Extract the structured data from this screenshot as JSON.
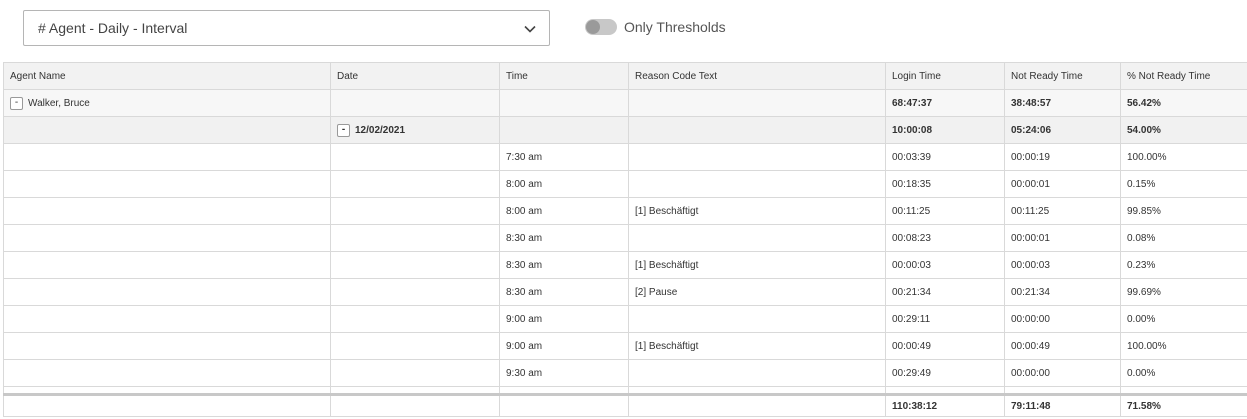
{
  "report_select": {
    "value": "# Agent - Daily - Interval"
  },
  "threshold_toggle": {
    "label": "Only Thresholds",
    "on": false
  },
  "table": {
    "columns": [
      "Agent Name",
      "Date",
      "Time",
      "Reason Code Text",
      "Login Time",
      "Not Ready Time",
      "% Not Ready Time"
    ],
    "group": {
      "expander": "-",
      "agent": "Walker, Bruce",
      "login": "68:47:37",
      "not_ready": "38:48:57",
      "pct": "56.42%"
    },
    "subgroup": {
      "expander": "-",
      "date": "12/02/2021",
      "login": "10:00:08",
      "not_ready": "05:24:06",
      "pct": "54.00%"
    },
    "rows": [
      {
        "time": "7:30 am",
        "reason": "",
        "login": "00:03:39",
        "not_ready": "00:00:19",
        "pct": "100.00%"
      },
      {
        "time": "8:00 am",
        "reason": "",
        "login": "00:18:35",
        "not_ready": "00:00:01",
        "pct": "0.15%"
      },
      {
        "time": "8:00 am",
        "reason": "[1] Beschäftigt",
        "login": "00:11:25",
        "not_ready": "00:11:25",
        "pct": "99.85%"
      },
      {
        "time": "8:30 am",
        "reason": "",
        "login": "00:08:23",
        "not_ready": "00:00:01",
        "pct": "0.08%"
      },
      {
        "time": "8:30 am",
        "reason": "[1] Beschäftigt",
        "login": "00:00:03",
        "not_ready": "00:00:03",
        "pct": "0.23%"
      },
      {
        "time": "8:30 am",
        "reason": "[2] Pause",
        "login": "00:21:34",
        "not_ready": "00:21:34",
        "pct": "99.69%"
      },
      {
        "time": "9:00 am",
        "reason": "",
        "login": "00:29:11",
        "not_ready": "00:00:00",
        "pct": "0.00%"
      },
      {
        "time": "9:00 am",
        "reason": "[1] Beschäftigt",
        "login": "00:00:49",
        "not_ready": "00:00:49",
        "pct": "100.00%"
      },
      {
        "time": "9:30 am",
        "reason": "",
        "login": "00:29:49",
        "not_ready": "00:00:00",
        "pct": "0.00%"
      }
    ],
    "totals": {
      "login": "110:38:12",
      "not_ready": "79:11:48",
      "pct": "71.58%"
    }
  },
  "icons": {
    "dropdown": "chevron-down-icon",
    "expander": "collapse-icon"
  }
}
